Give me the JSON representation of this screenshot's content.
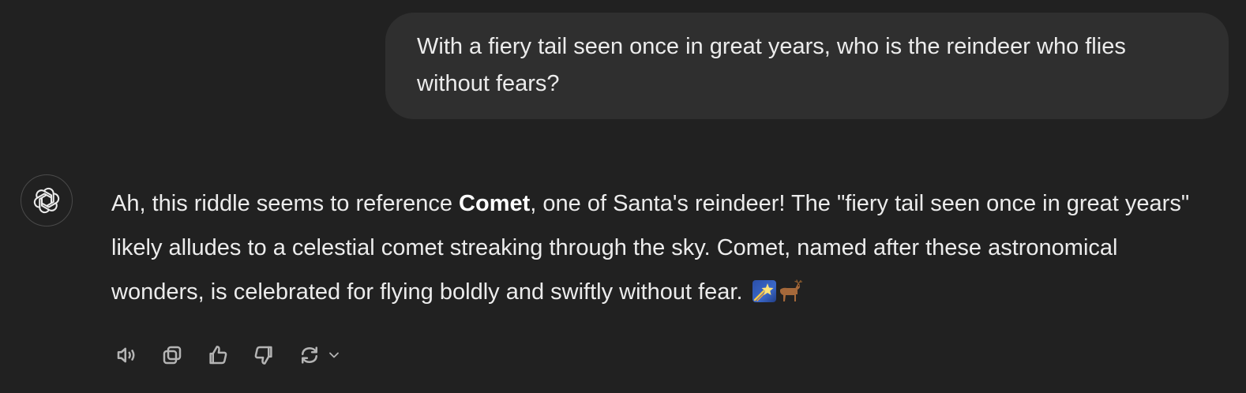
{
  "conversation": {
    "user_message": {
      "text": "With a fiery tail seen once in great years, who is the reindeer who flies without fears?"
    },
    "assistant_message": {
      "text_before_bold": "Ah, this riddle seems to reference ",
      "bold_text": "Comet",
      "text_after_bold": ", one of Santa's reindeer! The \"fiery tail seen once in great years\" likely alludes to a celestial comet streaking through the sky. Comet, named after these astronomical wonders, is celebrated for flying boldly and swiftly without fear. ",
      "emoji_1": "shooting-star-emoji",
      "emoji_2": "deer-emoji"
    },
    "actions": [
      {
        "name": "read-aloud",
        "icon": "speaker-icon"
      },
      {
        "name": "copy",
        "icon": "copy-icon"
      },
      {
        "name": "good-response",
        "icon": "thumbs-up-icon"
      },
      {
        "name": "bad-response",
        "icon": "thumbs-down-icon"
      },
      {
        "name": "regenerate",
        "icon": "refresh-icon"
      }
    ]
  },
  "colors": {
    "background": "#212121",
    "user_bubble": "#2f2f2f",
    "text": "#ececec",
    "icon": "#b4b4b4"
  }
}
